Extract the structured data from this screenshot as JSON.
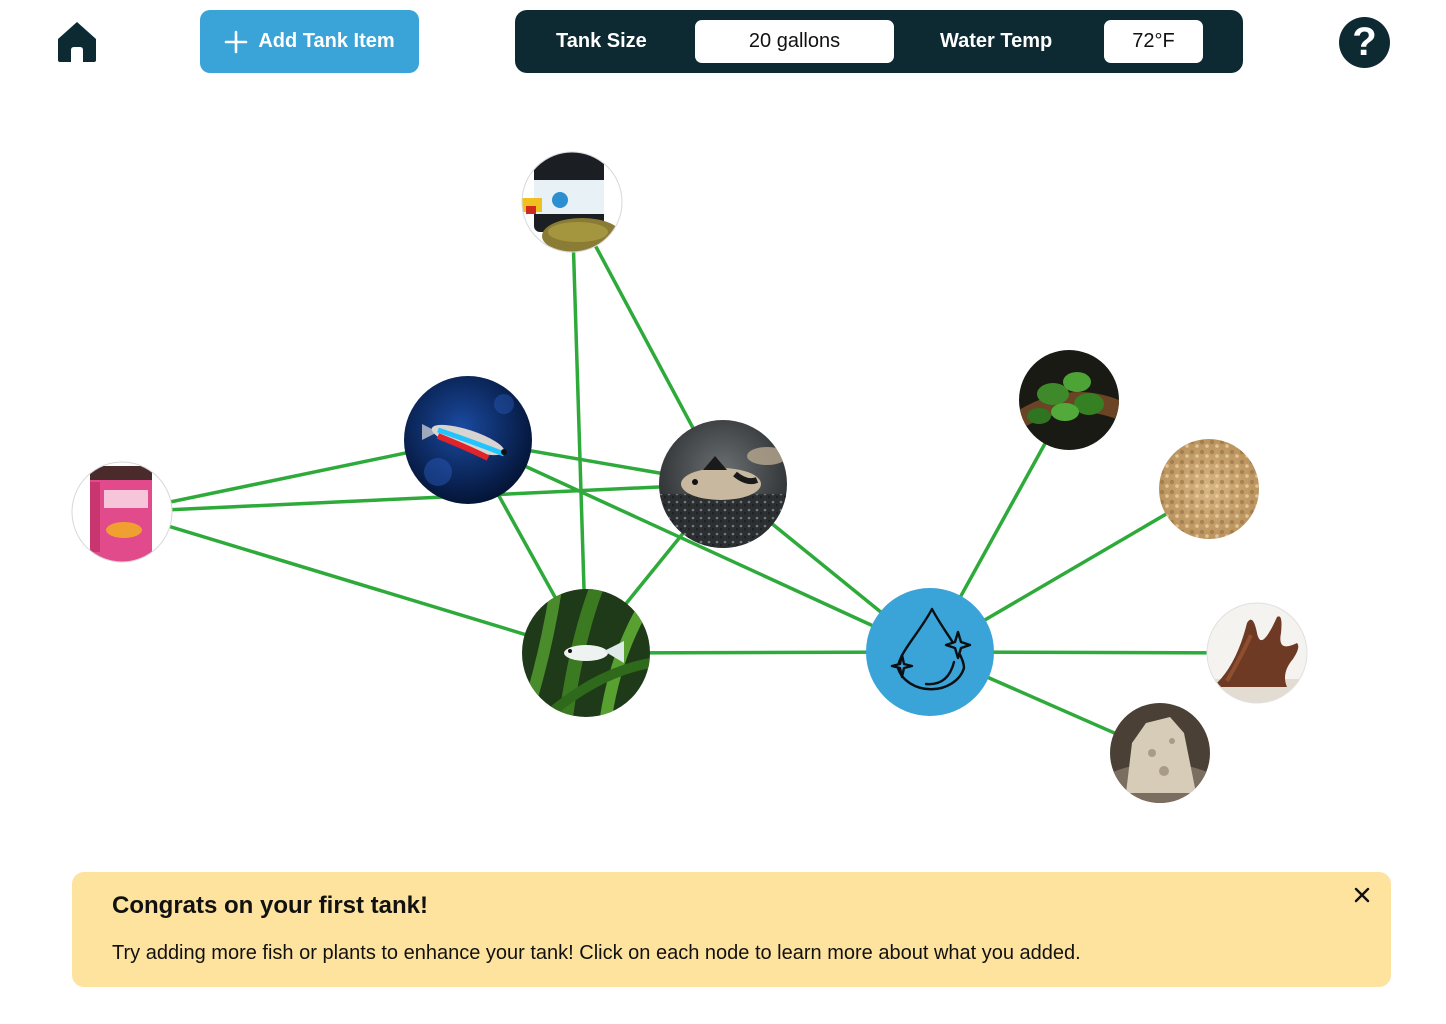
{
  "header": {
    "home_icon": "home-icon",
    "add_button_label": "Add Tank Item",
    "tank_size_label": "Tank Size",
    "tank_size_value": "20 gallons",
    "water_temp_label": "Water Temp",
    "water_temp_value": "72°F",
    "help_label": "?"
  },
  "colors": {
    "navy": "#0d2a33",
    "accent_blue": "#3aa3d8",
    "edge_green": "#2eaa3a",
    "toast_bg": "#fde39e"
  },
  "graph": {
    "nodes": [
      {
        "id": "sinking-pellets",
        "kind": "food",
        "icon": "sinking-pellets-jar"
      },
      {
        "id": "blood-worms",
        "kind": "food",
        "icon": "blood-worms-jar"
      },
      {
        "id": "neon-tetra",
        "kind": "fish",
        "icon": "neon-tetra-fish"
      },
      {
        "id": "corydoras",
        "kind": "fish",
        "icon": "corydoras-catfish"
      },
      {
        "id": "guppy",
        "kind": "fish",
        "icon": "guppy-fish"
      },
      {
        "id": "water",
        "kind": "hub",
        "icon": "water-drop-icon"
      },
      {
        "id": "anubias",
        "kind": "plant",
        "icon": "anubias-plant"
      },
      {
        "id": "gravel",
        "kind": "substrate",
        "icon": "gravel-substrate"
      },
      {
        "id": "driftwood",
        "kind": "decor",
        "icon": "driftwood-decor"
      },
      {
        "id": "rock",
        "kind": "decor",
        "icon": "rock-decor"
      }
    ],
    "edges": [
      [
        "sinking-pellets",
        "corydoras"
      ],
      [
        "sinking-pellets",
        "guppy"
      ],
      [
        "blood-worms",
        "neon-tetra"
      ],
      [
        "blood-worms",
        "corydoras"
      ],
      [
        "blood-worms",
        "guppy"
      ],
      [
        "neon-tetra",
        "corydoras"
      ],
      [
        "neon-tetra",
        "guppy"
      ],
      [
        "neon-tetra",
        "water"
      ],
      [
        "corydoras",
        "guppy"
      ],
      [
        "corydoras",
        "water"
      ],
      [
        "guppy",
        "water"
      ],
      [
        "water",
        "anubias"
      ],
      [
        "water",
        "gravel"
      ],
      [
        "water",
        "driftwood"
      ],
      [
        "water",
        "rock"
      ]
    ]
  },
  "toast": {
    "title": "Congrats on your first tank!",
    "body": "Try adding more fish or plants to enhance your tank! Click on each node to learn more about what you added.",
    "close_icon": "close-icon"
  }
}
